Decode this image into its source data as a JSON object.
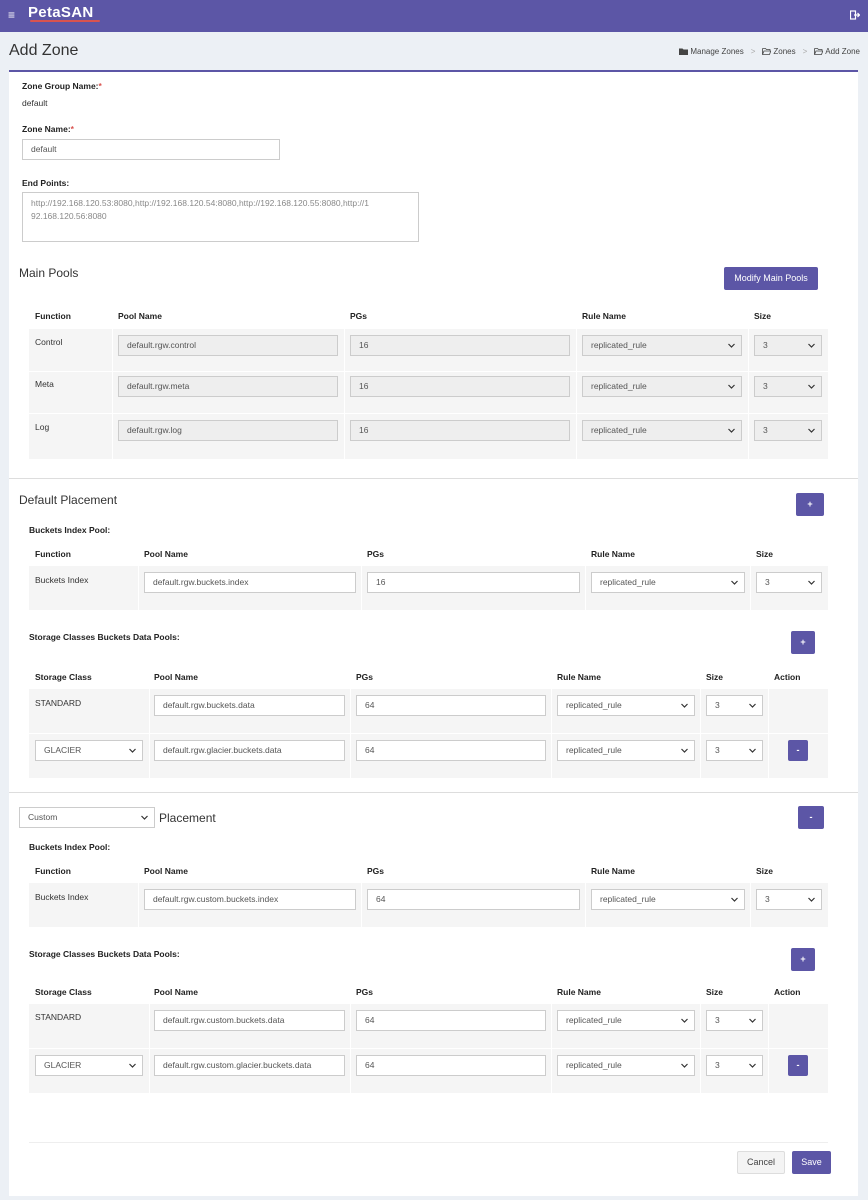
{
  "app": {
    "logo": "PetaSAN",
    "hamburger": "≡"
  },
  "page": {
    "title": "Add Zone"
  },
  "breadcrumb": [
    "Manage Zones",
    "Zones",
    "Add Zone"
  ],
  "form": {
    "zone_group_label": "Zone Group Name:",
    "zone_group_value": "default",
    "zone_name_label": "Zone Name:",
    "zone_name_value": "default",
    "endpoints_label": "End Points:",
    "endpoints_value": "http://192.168.120.53:8080,http://192.168.120.54:8080,http://192.168.120.55:8080,http://1\n92.168.120.56:8080",
    "required_mark": "*"
  },
  "main_pools": {
    "title": "Main Pools",
    "modify_button": "Modify Main Pools",
    "headers": [
      "Function",
      "Pool Name",
      "PGs",
      "Rule Name",
      "Size"
    ],
    "rows": [
      {
        "function": "Control",
        "pool": "default.rgw.control",
        "pgs": "16",
        "rule": "replicated_rule",
        "size": "3"
      },
      {
        "function": "Meta",
        "pool": "default.rgw.meta",
        "pgs": "16",
        "rule": "replicated_rule",
        "size": "3"
      },
      {
        "function": "Log",
        "pool": "default.rgw.log",
        "pgs": "16",
        "rule": "replicated_rule",
        "size": "3"
      }
    ]
  },
  "default_placement": {
    "title": "Default Placement",
    "add_button": "+",
    "index_label": "Buckets Index Pool:",
    "index_headers": [
      "Function",
      "Pool Name",
      "PGs",
      "Rule Name",
      "Size"
    ],
    "index_row": {
      "function": "Buckets Index",
      "pool": "default.rgw.buckets.index",
      "pgs": "16",
      "rule": "replicated_rule",
      "size": "3"
    },
    "data_label": "Storage Classes Buckets Data Pools:",
    "data_add_button": "+",
    "data_headers": [
      "Storage Class",
      "Pool Name",
      "PGs",
      "Rule Name",
      "Size",
      "Action"
    ],
    "data_rows": [
      {
        "class": "STANDARD",
        "pool": "default.rgw.buckets.data",
        "pgs": "64",
        "rule": "replicated_rule",
        "size": "3"
      },
      {
        "class": "GLACIER",
        "pool": "default.rgw.glacier.buckets.data",
        "pgs": "64",
        "rule": "replicated_rule",
        "size": "3",
        "action": "-"
      }
    ]
  },
  "custom_placement": {
    "select_value": "Custom",
    "title": "Placement",
    "remove_button": "-",
    "index_label": "Buckets Index Pool:",
    "index_headers": [
      "Function",
      "Pool Name",
      "PGs",
      "Rule Name",
      "Size"
    ],
    "index_row": {
      "function": "Buckets Index",
      "pool": "default.rgw.custom.buckets.index",
      "pgs": "64",
      "rule": "replicated_rule",
      "size": "3"
    },
    "data_label": "Storage Classes Buckets Data Pools:",
    "data_add_button": "+",
    "data_headers": [
      "Storage Class",
      "Pool Name",
      "PGs",
      "Rule Name",
      "Size",
      "Action"
    ],
    "data_rows": [
      {
        "class": "STANDARD",
        "pool": "default.rgw.custom.buckets.data",
        "pgs": "64",
        "rule": "replicated_rule",
        "size": "3"
      },
      {
        "class": "GLACIER",
        "pool": "default.rgw.custom.glacier.buckets.data",
        "pgs": "64",
        "rule": "replicated_rule",
        "size": "3",
        "action": "-"
      }
    ]
  },
  "footer": {
    "cancel": "Cancel",
    "save": "Save"
  },
  "colors": {
    "brand": "#5c56a6",
    "required": "#d9534f"
  }
}
